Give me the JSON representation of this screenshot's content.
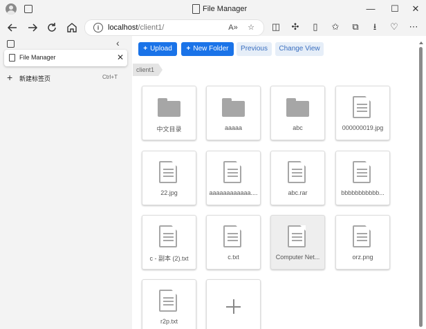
{
  "window": {
    "title": "File Manager",
    "controls": {
      "minimize": "—",
      "maximize": "☐",
      "close": "✕"
    }
  },
  "address_bar": {
    "host": "localhost",
    "path": "/client1/"
  },
  "sidebar": {
    "tab_title": "File Manager",
    "new_tab_label": "新建标签页",
    "new_tab_shortcut": "Ctrl+T"
  },
  "toolbar": {
    "upload_label": "Upload",
    "new_folder_label": "New Folder",
    "previous_label": "Previous",
    "change_view_label": "Change View"
  },
  "breadcrumb": {
    "current": "client1"
  },
  "items": [
    {
      "name": "中文目录",
      "type": "folder",
      "selected": false
    },
    {
      "name": "aaaaa",
      "type": "folder",
      "selected": false
    },
    {
      "name": "abc",
      "type": "folder",
      "selected": false
    },
    {
      "name": "000000019.jpg",
      "type": "file",
      "selected": false
    },
    {
      "name": "22.jpg",
      "type": "file",
      "selected": false
    },
    {
      "name": "aaaaaaaaaaaa....",
      "type": "file",
      "selected": false
    },
    {
      "name": "abc.rar",
      "type": "file",
      "selected": false
    },
    {
      "name": "bbbbbbbbbbb...",
      "type": "file",
      "selected": false
    },
    {
      "name": "c - 副本 (2).txt",
      "type": "file",
      "selected": false
    },
    {
      "name": "c.txt",
      "type": "file",
      "selected": false
    },
    {
      "name": "Computer Net...",
      "type": "file",
      "selected": true
    },
    {
      "name": "orz.png",
      "type": "file",
      "selected": false
    },
    {
      "name": "r2p.txt",
      "type": "file",
      "selected": false
    }
  ],
  "colors": {
    "primary": "#1a73e8",
    "secondary_bg": "#e6eef8",
    "icon_gray": "#a6a6a6"
  }
}
